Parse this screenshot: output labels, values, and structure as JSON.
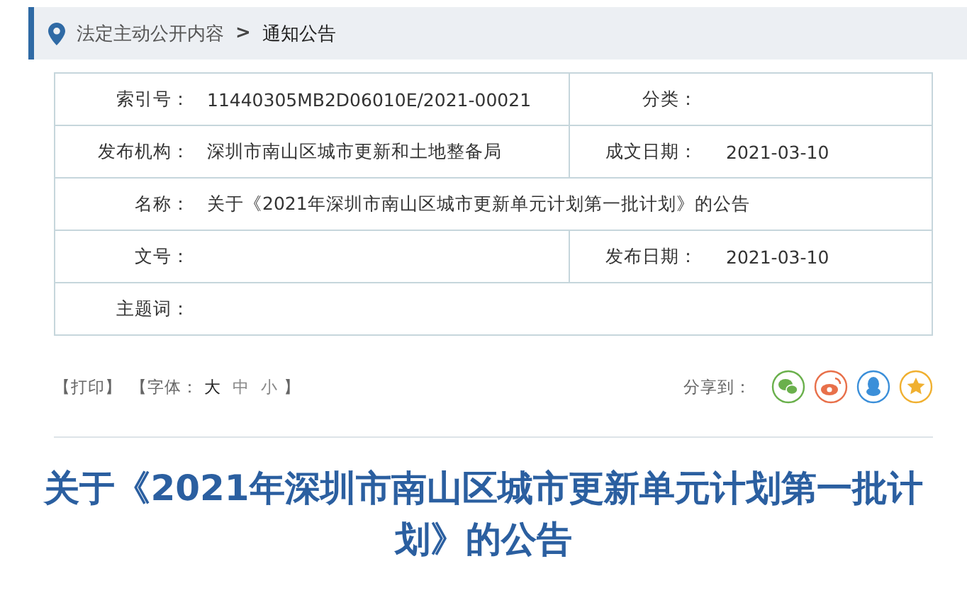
{
  "breadcrumb": {
    "items": [
      {
        "label": "法定主动公开内容",
        "current": false
      },
      {
        "label": "通知公告",
        "current": true
      }
    ],
    "separator": ">"
  },
  "info_table": {
    "rows": [
      {
        "kind": "split",
        "cells": [
          {
            "label": "索引号：",
            "value": "11440305MB2D06010E/2021-00021"
          },
          {
            "label": "分类："
          }
        ]
      },
      {
        "kind": "split",
        "cells": [
          {
            "label": "发布机构：",
            "value": "深圳市南山区城市更新和土地整备局"
          },
          {
            "label": "成文日期：",
            "value": "2021-03-10"
          }
        ]
      },
      {
        "kind": "full",
        "cells": [
          {
            "label": "名称：",
            "value": "关于《2021年深圳市南山区城市更新单元计划第一批计划》的公告"
          }
        ]
      },
      {
        "kind": "split",
        "cells": [
          {
            "label": "文号："
          },
          {
            "label": "发布日期：",
            "value": "2021-03-10"
          }
        ]
      },
      {
        "kind": "full",
        "cells": [
          {
            "label": "主题词："
          }
        ]
      }
    ]
  },
  "tools": {
    "print": "【打印】",
    "font_label": "【字体：",
    "font_sizes": [
      {
        "label": "大",
        "selected": true
      },
      {
        "label": "中",
        "selected": false
      },
      {
        "label": "小",
        "selected": false
      }
    ],
    "font_end": "】"
  },
  "share": {
    "label": "分享到：",
    "buttons": [
      {
        "kind": "wechat",
        "color": "#6ab04c"
      },
      {
        "kind": "weibo",
        "color": "#e8704a"
      },
      {
        "kind": "qq",
        "color": "#3b8fd9"
      },
      {
        "kind": "favorite",
        "color": "#f0b030"
      }
    ]
  },
  "article": {
    "title": "关于《2021年深圳市南山区城市更新单元计划第一批计划》的公告"
  }
}
